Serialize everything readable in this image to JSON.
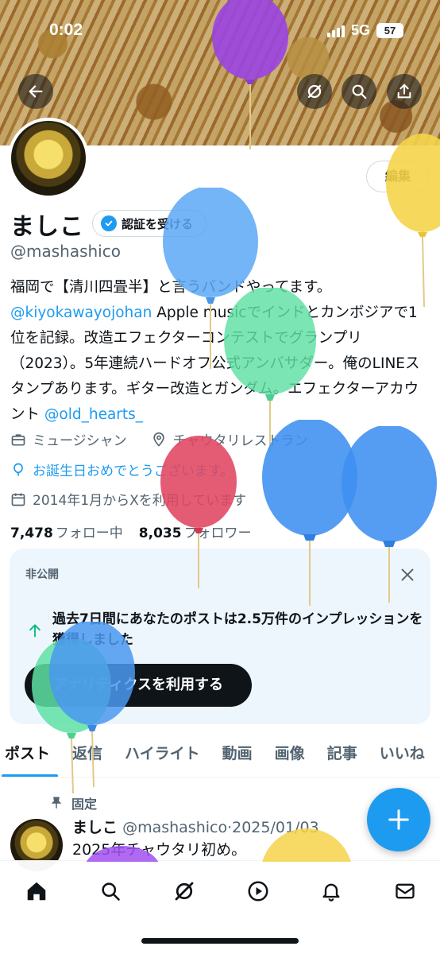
{
  "status_bar": {
    "time": "0:02",
    "network": "5G",
    "battery": "57"
  },
  "header": {
    "back_icon": "arrow-left-icon",
    "actions": [
      "grok-icon",
      "search-icon",
      "share-icon"
    ],
    "edit_label": "編集"
  },
  "profile": {
    "name": "ましこ",
    "verify_label": "認証を受ける",
    "handle": "@mashashico",
    "bio": {
      "line1": "福岡で【清川四畳半】と言うバンドやってます。",
      "mention1": "@kiyokawayojohan",
      "part2": " Apple musicでインドとカンボジアで1位を記録。改造エフェクターコンテストでグランプリ（2023）。5年連続ハードオフ公式アンバサダー。俺のLINEスタンプあります。ギター改造とガンダム。エフェクターアカウント ",
      "mention2": "@old_hearts_"
    },
    "category": "ミュージシャン",
    "location": "チャウタリレストラン",
    "birthday": "お誕生日おめでとうございます。",
    "joined": "2014年1月からXを利用しています",
    "following_count": "7,478",
    "following_label": "フォロー中",
    "followers_count": "8,035",
    "followers_label": "フォロワー"
  },
  "insight_card": {
    "tag": "非公開",
    "text": "過去7日間にあなたのポストは2.5万件のインプレッションを獲得しました",
    "cta": "アナリティクスを利用する"
  },
  "tabs": [
    "ポスト",
    "返信",
    "ハイライト",
    "動画",
    "画像",
    "記事",
    "いいね"
  ],
  "pinned_post": {
    "pinned_label": "固定",
    "author": "ましこ",
    "handle_date": "@mashashico·2025/01/03",
    "text": "2025年チャウタリ初め。"
  },
  "bottom_nav": [
    "home-icon",
    "search-icon",
    "grok-icon",
    "video-icon",
    "notifications-icon",
    "messages-icon"
  ],
  "colors": {
    "accent": "#1d9bf0",
    "text": "#0f1419",
    "secondary": "#536471",
    "card_bg": "#eef6fd"
  }
}
